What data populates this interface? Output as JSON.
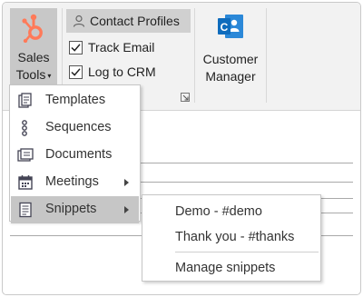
{
  "ribbon": {
    "sales_tools": {
      "label_line1": "Sales",
      "label_line2": "Tools",
      "caret": "▾",
      "icon": "hubspot-sprocket-icon"
    },
    "contact_profiles": {
      "label": "Contact Profiles",
      "icon": "person-icon"
    },
    "track_email": {
      "label": "Track Email",
      "checked": true
    },
    "log_to_crm": {
      "label": "Log to CRM",
      "checked": true
    },
    "customer_manager": {
      "label_line1": "Customer",
      "label_line2": "Manager",
      "icon": "customer-manager-icon"
    }
  },
  "sales_tools_menu": {
    "items": [
      {
        "label": "Templates",
        "icon": "templates-icon",
        "has_submenu": false,
        "active": false
      },
      {
        "label": "Sequences",
        "icon": "sequences-icon",
        "has_submenu": false,
        "active": false
      },
      {
        "label": "Documents",
        "icon": "documents-icon",
        "has_submenu": false,
        "active": false
      },
      {
        "label": "Meetings",
        "icon": "calendar-icon",
        "has_submenu": true,
        "active": false
      },
      {
        "label": "Snippets",
        "icon": "snippets-icon",
        "has_submenu": true,
        "active": true
      }
    ]
  },
  "snippets_submenu": {
    "items": [
      {
        "label": "Demo - #demo"
      },
      {
        "label": "Thank you - #thanks"
      }
    ],
    "manage_label": "Manage snippets"
  },
  "colors": {
    "hubspot_orange": "#ff7a59",
    "outlook_blue": "#0f6cbd",
    "menu_highlight": "#c6c6c6"
  }
}
